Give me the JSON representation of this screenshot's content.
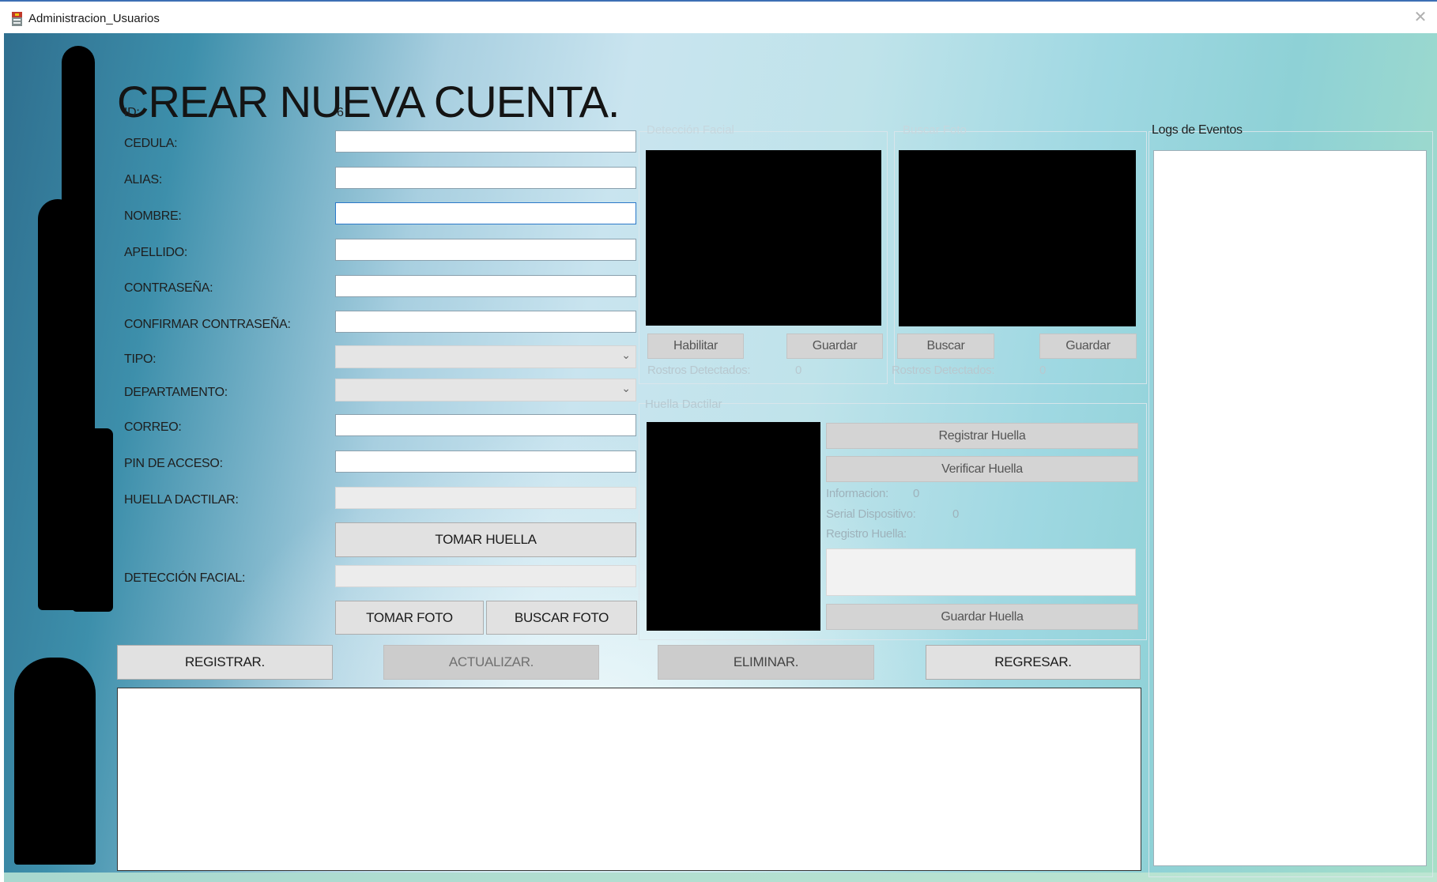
{
  "window": {
    "title": "Administracion_Usuarios",
    "close_glyph": "✕"
  },
  "heading": "CREAR NUEVA CUENTA.",
  "form": {
    "id_label": "ID:",
    "id_value": "6",
    "cedula_label": "CEDULA:",
    "alias_label": "ALIAS:",
    "nombre_label": "NOMBRE:",
    "apellido_label": "APELLIDO:",
    "contrasena_label": "CONTRASEÑA:",
    "confirmar_label": "CONFIRMAR CONTRASEÑA:",
    "tipo_label": "TIPO:",
    "departamento_label": "DEPARTAMENTO:",
    "correo_label": "CORREO:",
    "pin_label": "PIN DE ACCESO:",
    "huella_label": "HUELLA DACTILAR:",
    "deteccion_label": "DETECCIÓN FACIAL:",
    "tomar_huella": "TOMAR HUELLA",
    "tomar_foto": "TOMAR FOTO",
    "buscar_foto": "BUSCAR FOTO"
  },
  "actions": {
    "registrar": "REGISTRAR.",
    "actualizar": "ACTUALIZAR.",
    "eliminar": "ELIMINAR.",
    "regresar": "REGRESAR."
  },
  "deteccion_facial": {
    "title": "Detección Facial",
    "habilitar": "Habilitar",
    "guardar": "Guardar",
    "rostros_label": "Rostros Detectados:",
    "rostros_value": "0"
  },
  "buscar_foto_group": {
    "title": "Buscar Foto",
    "buscar": "Buscar",
    "guardar": "Guardar",
    "rostros_label": "Rostros Detectados:",
    "rostros_value": "0"
  },
  "huella": {
    "title": "Huella Dactilar",
    "registrar": "Registrar Huella",
    "verificar": "Verificar Huella",
    "informacion_label": "Informacion:",
    "informacion_value": "0",
    "serial_label": "Serial Dispositivo:",
    "serial_value": "0",
    "registro_label": "Registro Huella:",
    "guardar": "Guardar Huella"
  },
  "logs": {
    "title": "Logs de Eventos"
  },
  "icons": {
    "app": "app-icon",
    "close": "close-icon",
    "chevron": "chevron-down-icon"
  },
  "colors": {
    "accent": "#3c6fb4"
  }
}
